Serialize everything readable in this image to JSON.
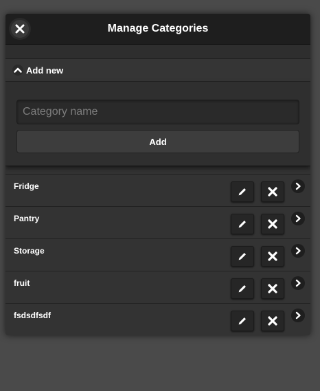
{
  "dialog": {
    "title": "Manage Categories",
    "close_icon": "close-icon"
  },
  "add_section": {
    "toggle_label": "Add new",
    "toggle_icon": "chevron-up-icon",
    "input_value": "",
    "input_placeholder": "Category name",
    "add_label": "Add"
  },
  "categories": [
    {
      "name": "Fridge"
    },
    {
      "name": "Pantry"
    },
    {
      "name": "Storage"
    },
    {
      "name": "fruit"
    },
    {
      "name": "fsdsdfsdf"
    }
  ],
  "row_icons": {
    "edit": "pencil-icon",
    "delete": "delete-icon",
    "open": "chevron-right-icon"
  }
}
